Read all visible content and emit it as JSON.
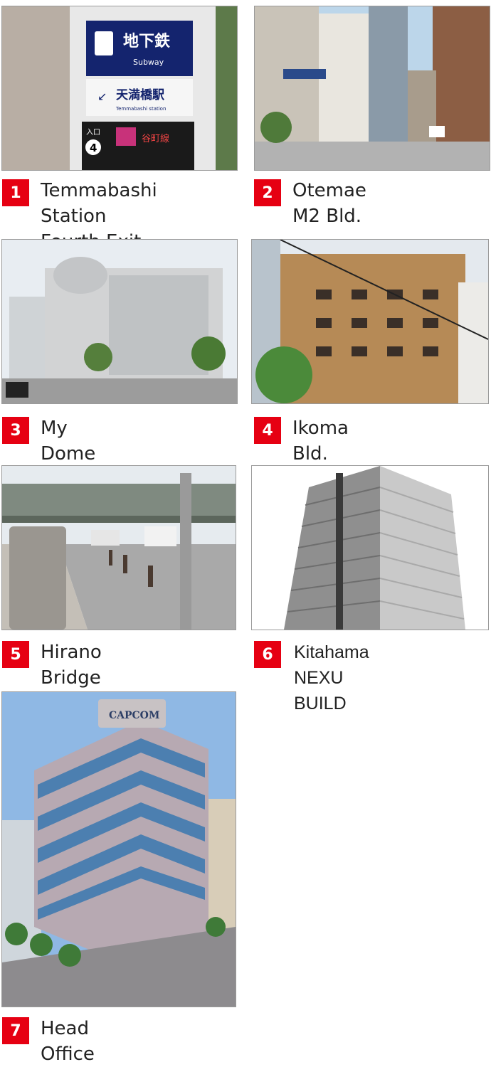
{
  "locations": [
    {
      "number": "1",
      "label": "Temmabashi Station\nFourth Exit",
      "icon": "subway-sign-photo",
      "sign": {
        "jp": "地下鉄",
        "en": "Subway",
        "station_jp": "天満橋駅",
        "station_en": "Temmabashi station",
        "exit": "4",
        "exit_label": "入口",
        "line": "谷町線"
      }
    },
    {
      "number": "2",
      "label": "Otemae M2 Bld.",
      "icon": "street-photo"
    },
    {
      "number": "3",
      "label": "My Dome Osaka",
      "icon": "building-photo"
    },
    {
      "number": "4",
      "label": "Ikoma Bld.",
      "icon": "building-photo"
    },
    {
      "number": "5",
      "label": "Hirano Bridge",
      "icon": "bridge-photo"
    },
    {
      "number": "6",
      "label": "Kitahama NEXU BUILD",
      "icon": "tower-photo"
    },
    {
      "number": "7",
      "label": "Head Office",
      "icon": "office-photo",
      "sign_text": "CAPCOM"
    }
  ],
  "colors": {
    "badge": "#e60012",
    "text": "#222222",
    "border": "#9a9a9a"
  }
}
